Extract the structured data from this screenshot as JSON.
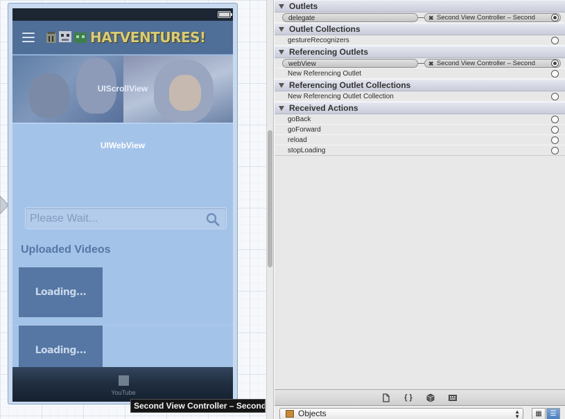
{
  "canvas": {
    "logo_text": "HATVENTURES!",
    "scroll_view_label": "UIScrollView",
    "web_view_label": "UIWebView",
    "search_placeholder": "Please Wait...",
    "videos_heading": "Uploaded Videos",
    "video_items": [
      {
        "label": "Loading..."
      },
      {
        "label": "Loading..."
      }
    ],
    "tab_label": "YouTube",
    "tooltip": "Second View Controller – Second"
  },
  "inspector": {
    "sections": {
      "outlets": {
        "title": "Outlets",
        "rows": [
          {
            "name": "delegate",
            "target": "Second View Controller – Second",
            "connected": true
          }
        ]
      },
      "outlet_collections": {
        "title": "Outlet Collections",
        "rows": [
          {
            "name": "gestureRecognizers"
          }
        ]
      },
      "referencing_outlets": {
        "title": "Referencing Outlets",
        "rows": [
          {
            "name": "webView",
            "target": "Second View Controller – Second",
            "connected": true
          },
          {
            "name": "New Referencing Outlet"
          }
        ]
      },
      "referencing_outlet_collections": {
        "title": "Referencing Outlet Collections",
        "rows": [
          {
            "name": "New Referencing Outlet Collection"
          }
        ]
      },
      "received_actions": {
        "title": "Received Actions",
        "rows": [
          {
            "name": "goBack"
          },
          {
            "name": "goForward"
          },
          {
            "name": "reload"
          },
          {
            "name": "stopLoading"
          }
        ]
      }
    }
  },
  "toolbar": {
    "icons": [
      "file-template-icon",
      "code-snippet-icon",
      "object-cube-icon",
      "media-icon"
    ]
  },
  "library": {
    "selected": "Objects"
  },
  "colors": {
    "nav_header": "#4f6e98",
    "web_view_overlay": "#a4c3e9",
    "tooltip_bg": "#151515",
    "inspector_bg": "#e8e8e8"
  }
}
